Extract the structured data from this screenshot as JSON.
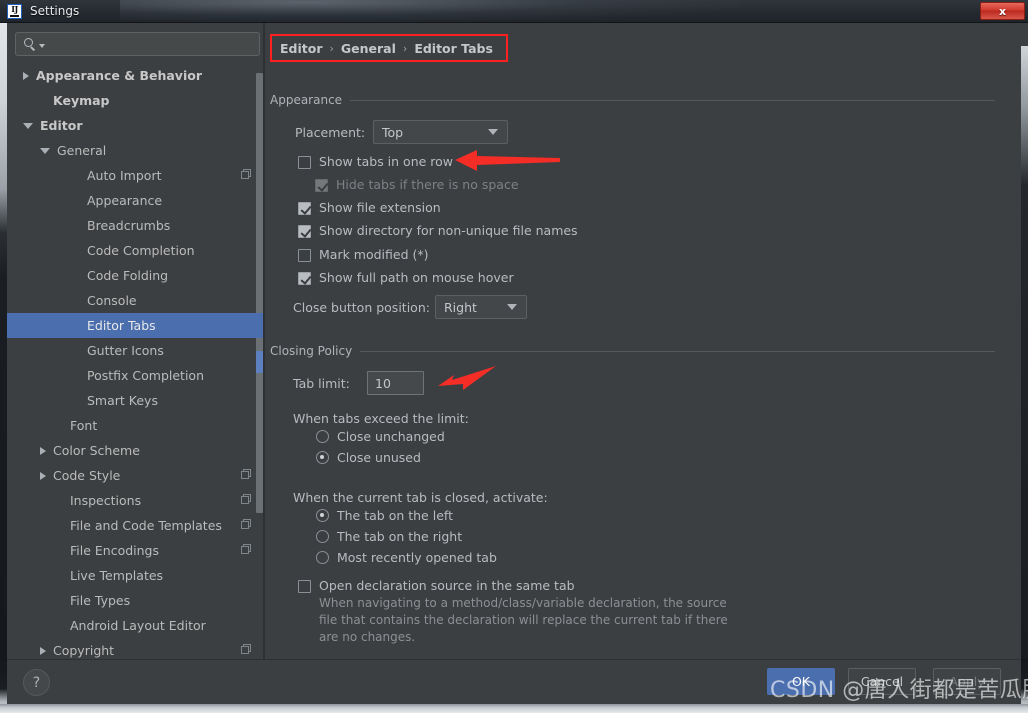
{
  "window": {
    "title": "Settings",
    "logo_icon": "intellij-idea-logo-icon",
    "close_label": "x"
  },
  "search": {
    "value": "",
    "placeholder": "",
    "icon": "search-icon"
  },
  "sidebar": {
    "items": [
      {
        "label": "Appearance & Behavior",
        "indent": 0,
        "twisty": "collapsed",
        "bold": true,
        "selected": false,
        "copy_icon": false
      },
      {
        "label": "Keymap",
        "indent": 1,
        "twisty": "none",
        "bold": true,
        "selected": false,
        "copy_icon": false
      },
      {
        "label": "Editor",
        "indent": 0,
        "twisty": "expanded",
        "bold": true,
        "selected": false,
        "copy_icon": false
      },
      {
        "label": "General",
        "indent": 1,
        "twisty": "expanded",
        "bold": false,
        "selected": false,
        "copy_icon": false
      },
      {
        "label": "Auto Import",
        "indent": 3,
        "twisty": "none",
        "bold": false,
        "selected": false,
        "copy_icon": true
      },
      {
        "label": "Appearance",
        "indent": 3,
        "twisty": "none",
        "bold": false,
        "selected": false,
        "copy_icon": false
      },
      {
        "label": "Breadcrumbs",
        "indent": 3,
        "twisty": "none",
        "bold": false,
        "selected": false,
        "copy_icon": false
      },
      {
        "label": "Code Completion",
        "indent": 3,
        "twisty": "none",
        "bold": false,
        "selected": false,
        "copy_icon": false
      },
      {
        "label": "Code Folding",
        "indent": 3,
        "twisty": "none",
        "bold": false,
        "selected": false,
        "copy_icon": false
      },
      {
        "label": "Console",
        "indent": 3,
        "twisty": "none",
        "bold": false,
        "selected": false,
        "copy_icon": false
      },
      {
        "label": "Editor Tabs",
        "indent": 3,
        "twisty": "none",
        "bold": false,
        "selected": true,
        "copy_icon": false
      },
      {
        "label": "Gutter Icons",
        "indent": 3,
        "twisty": "none",
        "bold": false,
        "selected": false,
        "copy_icon": false
      },
      {
        "label": "Postfix Completion",
        "indent": 3,
        "twisty": "none",
        "bold": false,
        "selected": false,
        "copy_icon": false
      },
      {
        "label": "Smart Keys",
        "indent": 3,
        "twisty": "none",
        "bold": false,
        "selected": false,
        "copy_icon": false
      },
      {
        "label": "Font",
        "indent": 2,
        "twisty": "none",
        "bold": false,
        "selected": false,
        "copy_icon": false
      },
      {
        "label": "Color Scheme",
        "indent": 1,
        "twisty": "collapsed",
        "bold": false,
        "selected": false,
        "copy_icon": false
      },
      {
        "label": "Code Style",
        "indent": 1,
        "twisty": "collapsed",
        "bold": false,
        "selected": false,
        "copy_icon": true
      },
      {
        "label": "Inspections",
        "indent": 2,
        "twisty": "none",
        "bold": false,
        "selected": false,
        "copy_icon": true
      },
      {
        "label": "File and Code Templates",
        "indent": 2,
        "twisty": "none",
        "bold": false,
        "selected": false,
        "copy_icon": true
      },
      {
        "label": "File Encodings",
        "indent": 2,
        "twisty": "none",
        "bold": false,
        "selected": false,
        "copy_icon": true
      },
      {
        "label": "Live Templates",
        "indent": 2,
        "twisty": "none",
        "bold": false,
        "selected": false,
        "copy_icon": false
      },
      {
        "label": "File Types",
        "indent": 2,
        "twisty": "none",
        "bold": false,
        "selected": false,
        "copy_icon": false
      },
      {
        "label": "Android Layout Editor",
        "indent": 2,
        "twisty": "none",
        "bold": false,
        "selected": false,
        "copy_icon": false
      },
      {
        "label": "Copyright",
        "indent": 1,
        "twisty": "collapsed",
        "bold": false,
        "selected": false,
        "copy_icon": true
      }
    ]
  },
  "breadcrumb": {
    "parts": [
      "Editor",
      "General",
      "Editor Tabs"
    ],
    "separator": "›",
    "highlight_color": "#ff2020"
  },
  "appearance_section": {
    "title": "Appearance",
    "placement_label": "Placement:",
    "placement_value": "Top",
    "close_button_label": "Close button position:",
    "close_button_value": "Right",
    "checkboxes": [
      {
        "label": "Show tabs in one row",
        "checked": false,
        "disabled": false
      },
      {
        "label": "Hide tabs if there is no space",
        "checked": true,
        "disabled": true
      },
      {
        "label": "Show file extension",
        "checked": true,
        "disabled": false
      },
      {
        "label": "Show directory for non-unique file names",
        "checked": true,
        "disabled": false
      },
      {
        "label": "Mark modified (*)",
        "checked": false,
        "disabled": false
      },
      {
        "label": "Show full path on mouse hover",
        "checked": true,
        "disabled": false
      }
    ]
  },
  "closing_policy_section": {
    "title": "Closing Policy",
    "tab_limit_label": "Tab limit:",
    "tab_limit_value": "10",
    "exceed_group_label": "When tabs exceed the limit:",
    "exceed_options": [
      {
        "label": "Close unchanged",
        "checked": false
      },
      {
        "label": "Close unused",
        "checked": true
      }
    ],
    "activate_group_label": "When the current tab is closed, activate:",
    "activate_options": [
      {
        "label": "The tab on the left",
        "checked": true
      },
      {
        "label": "The tab on the right",
        "checked": false
      },
      {
        "label": "Most recently opened tab",
        "checked": false
      }
    ],
    "open_declaration": {
      "label": "Open declaration source in the same tab",
      "checked": false,
      "description": "When navigating to a method/class/variable declaration, the source file that contains the declaration will replace the current tab if there are no changes."
    }
  },
  "footer": {
    "help_label": "?",
    "ok_label": "OK",
    "cancel_label": "Cancel",
    "apply_label": "Apply"
  },
  "watermark": {
    "text": "CSDN @唐人街都是苦瓜脸"
  }
}
